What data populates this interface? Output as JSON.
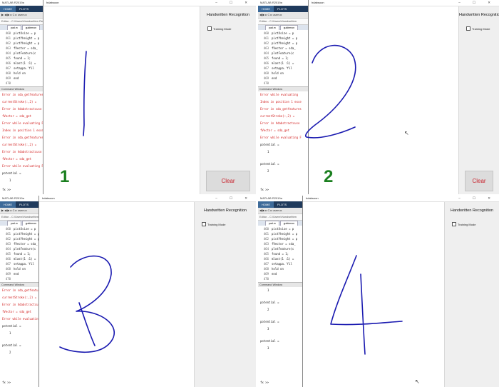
{
  "quadrants": [
    {
      "matlab": {
        "title": "MATLAB R2019a",
        "ribbon": [
          "HOME",
          "PLOTS"
        ],
        "toolbar": "▶ ◀ ▶ ▸ C ▸ users ▸",
        "path": "Editor - C:\\Users\\Handwritten Recognition",
        "tabs": [
          "pad.m",
          "guidemon"
        ],
        "code": [
          {
            "ln": "460",
            "text": "pictXsize = p"
          },
          {
            "ln": "461",
            "text": "pictYheight = p"
          },
          {
            "ln": "462",
            "text": "pictYheight = p"
          },
          {
            "ln": "463",
            "text": "fVector = sda_"
          },
          {
            "ln": "464",
            "text": "plotFeature(c"
          },
          {
            "ln": "465",
            "text": "found = 1;"
          },
          {
            "ln": "466",
            "text": "mlast(1 :1) ="
          },
          {
            "ln": "467",
            "text": "setappa.'fil"
          },
          {
            "ln": "468",
            "text": "hold on"
          },
          {
            "ln": "469",
            "text": "end"
          },
          {
            "ln": "470",
            "text": ""
          }
        ],
        "cw_title": "Command Window",
        "cw": [
          {
            "kind": "err",
            "text": "Error in sda_getfeatures"
          },
          {
            "kind": "err",
            "text": "  currentStroke(:,2) ="
          },
          {
            "kind": "err",
            "text": "Error in hdabstractcuso"
          },
          {
            "kind": "err",
            "text": "  fVector = sda_get"
          },
          {
            "kind": "err",
            "text": "Error while evaluating F"
          },
          {
            "kind": "err",
            "text": "Index in position 1 exce"
          },
          {
            "kind": "err",
            "text": "Error in sda_getfeatures"
          },
          {
            "kind": "err",
            "text": "  currentStroke(:,2) ="
          },
          {
            "kind": "err",
            "text": "Error in hdabstractcuso"
          },
          {
            "kind": "err",
            "text": "  fVector = sda_get"
          },
          {
            "kind": "err",
            "text": "Error while evaluating F"
          },
          {
            "kind": "plain",
            "text": "potential ="
          },
          {
            "kind": "val",
            "text": "1"
          }
        ],
        "prompt": "fx >>"
      },
      "app": {
        "title": "hdabsoon",
        "controls": "– ☐ ✕",
        "panel_title": "Handwritten Recognition",
        "training_label": "Training Mode",
        "clear_label": "Clear",
        "digit_label": "1",
        "ink_color": "#1a1ab0"
      }
    },
    {
      "matlab": {
        "title": "MATLAB R2019a",
        "ribbon": [
          "HOME",
          "PLOTS"
        ],
        "toolbar": "◀ ▶ ▸ C ▸ users ▸",
        "path": "Editor - C:\\Users\\Handwritten",
        "tabs": [
          "pad.m",
          "guidemon"
        ],
        "code": [
          {
            "ln": "460",
            "text": "pictXsize = p"
          },
          {
            "ln": "461",
            "text": "pictYheight = p"
          },
          {
            "ln": "462",
            "text": "pictYheight = p"
          },
          {
            "ln": "463",
            "text": "fVector = sda_"
          },
          {
            "ln": "464",
            "text": "plotFeature(c"
          },
          {
            "ln": "465",
            "text": "found = 1;"
          },
          {
            "ln": "466",
            "text": "mlast(1 :1) ="
          },
          {
            "ln": "467",
            "text": "setappa.'fil"
          },
          {
            "ln": "468",
            "text": "hold on"
          },
          {
            "ln": "469",
            "text": "end"
          },
          {
            "ln": "470",
            "text": ""
          }
        ],
        "cw_title": "Command Window",
        "cw": [
          {
            "kind": "err",
            "text": "Error while evaluating"
          },
          {
            "kind": "err",
            "text": "Index in position 1 exce"
          },
          {
            "kind": "err",
            "text": "Error in sda_getfeatures"
          },
          {
            "kind": "err",
            "text": "  currentStroke(:,2) ="
          },
          {
            "kind": "err",
            "text": "Error in hdabstractcuso"
          },
          {
            "kind": "err",
            "text": "  fVector = sda_get"
          },
          {
            "kind": "err",
            "text": "Error while evaluating F"
          },
          {
            "kind": "plain",
            "text": "potential ="
          },
          {
            "kind": "val",
            "text": "1"
          },
          {
            "kind": "plain",
            "text": "potential ="
          },
          {
            "kind": "val",
            "text": "2"
          }
        ],
        "prompt": "fx >>"
      },
      "app": {
        "title": "hdabsoon",
        "controls": "– ☐ ✕",
        "panel_title": "Handwritten Recognition",
        "training_label": "Training Mode",
        "clear_label": "Clear",
        "digit_label": "2",
        "ink_color": "#1a1ab0"
      }
    },
    {
      "matlab": {
        "title": "MATLAB R2019a",
        "ribbon": [
          "HOME",
          "PLOTS"
        ],
        "toolbar": "▶ ◀ ▶ ▸ C ▸ users ▸",
        "path": "Editor - C:\\Users\\Handwritten",
        "tabs": [
          "pad.m",
          "guidemon"
        ],
        "code": [
          {
            "ln": "460",
            "text": "pictXsize = p"
          },
          {
            "ln": "461",
            "text": "pictYheight = p"
          },
          {
            "ln": "462",
            "text": "pictYheight = p"
          },
          {
            "ln": "463",
            "text": "fVector = sda_"
          },
          {
            "ln": "464",
            "text": "plotFeature(c"
          },
          {
            "ln": "465",
            "text": "found = 1;"
          },
          {
            "ln": "466",
            "text": "mlast(1 :1) ="
          },
          {
            "ln": "467",
            "text": "setappa.'fil"
          },
          {
            "ln": "468",
            "text": "hold on"
          },
          {
            "ln": "469",
            "text": "end"
          },
          {
            "ln": "470",
            "text": ""
          }
        ],
        "cw_title": "Command Window",
        "cw": [
          {
            "kind": "err",
            "text": "Error in sda_getfeatures"
          },
          {
            "kind": "err",
            "text": "  currentStroke(:,2) ="
          },
          {
            "kind": "err",
            "text": "Error in hdabstractcuso"
          },
          {
            "kind": "err",
            "text": "  fVector = sda_get"
          },
          {
            "kind": "err",
            "text": "Error while evaluating F"
          },
          {
            "kind": "plain",
            "text": "potential ="
          },
          {
            "kind": "val",
            "text": "1"
          },
          {
            "kind": "plain",
            "text": "potential ="
          },
          {
            "kind": "val",
            "text": "2"
          }
        ],
        "prompt": "fx >>"
      },
      "app": {
        "title": "hdabsoon",
        "controls": "– ☐ ✕",
        "panel_title": "Handwritten Recognition",
        "training_label": "Training Mode",
        "clear_label": "",
        "digit_label": "",
        "ink_color": "#1a1ab0"
      }
    },
    {
      "matlab": {
        "title": "MATLAB R2019a",
        "ribbon": [
          "HOME",
          "PLOTS"
        ],
        "toolbar": "◀ ▶ ▸ C ▸ users ▸",
        "path": "Editor - C:\\Users\\Handwritten",
        "tabs": [
          "pad.m",
          "guidemon"
        ],
        "code": [
          {
            "ln": "460",
            "text": "pictXsize = p"
          },
          {
            "ln": "461",
            "text": "pictYheight = p"
          },
          {
            "ln": "462",
            "text": "pictYheight = p"
          },
          {
            "ln": "463",
            "text": "fVector = sda_"
          },
          {
            "ln": "464",
            "text": "plotFeature(c"
          },
          {
            "ln": "465",
            "text": "found = 1;"
          },
          {
            "ln": "466",
            "text": "mlast(1 :1) ="
          },
          {
            "ln": "467",
            "text": "setappa.'fil"
          },
          {
            "ln": "468",
            "text": "hold on"
          },
          {
            "ln": "469",
            "text": "end"
          },
          {
            "ln": "470",
            "text": ""
          }
        ],
        "cw_title": "Command Window",
        "cw": [
          {
            "kind": "val",
            "text": "1"
          },
          {
            "kind": "plain",
            "text": "potential ="
          },
          {
            "kind": "val",
            "text": "2"
          },
          {
            "kind": "plain",
            "text": "potential ="
          },
          {
            "kind": "val",
            "text": "3"
          },
          {
            "kind": "plain",
            "text": "potential ="
          },
          {
            "kind": "val",
            "text": "3"
          }
        ],
        "prompt": "fx >>"
      },
      "app": {
        "title": "hdabsoon",
        "controls": "– ☐ ✕",
        "panel_title": "Handwritten Recognition",
        "training_label": "Training Mode",
        "clear_label": "",
        "digit_label": "",
        "ink_color": "#1a1ab0"
      }
    }
  ]
}
